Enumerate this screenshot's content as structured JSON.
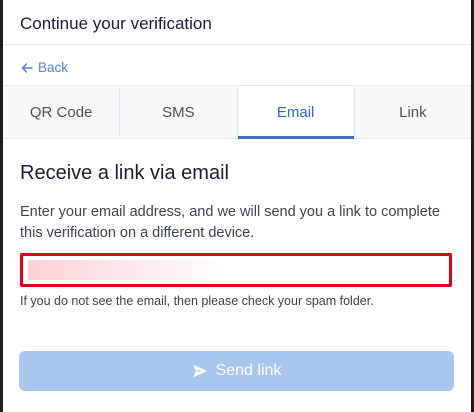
{
  "header": {
    "title": "Continue your verification"
  },
  "back": {
    "label": "Back",
    "icon": "arrow-left-icon"
  },
  "tabs": [
    {
      "label": "QR Code",
      "active": false
    },
    {
      "label": "SMS",
      "active": false
    },
    {
      "label": "Email",
      "active": true
    },
    {
      "label": "Link",
      "active": false
    }
  ],
  "email_section": {
    "heading": "Receive a link via email",
    "description": "Enter your email address, and we will send you a link to complete this verification on a different device.",
    "email_value": "",
    "spam_hint": "If you do not see the email, then please check your spam folder."
  },
  "send_button": {
    "label": "Send link",
    "icon": "send-icon",
    "disabled": true
  },
  "colors": {
    "accent": "#3f72c4",
    "link": "#4f86d6",
    "highlight_border": "#e0001a",
    "button_disabled": "#a9c6ee"
  }
}
